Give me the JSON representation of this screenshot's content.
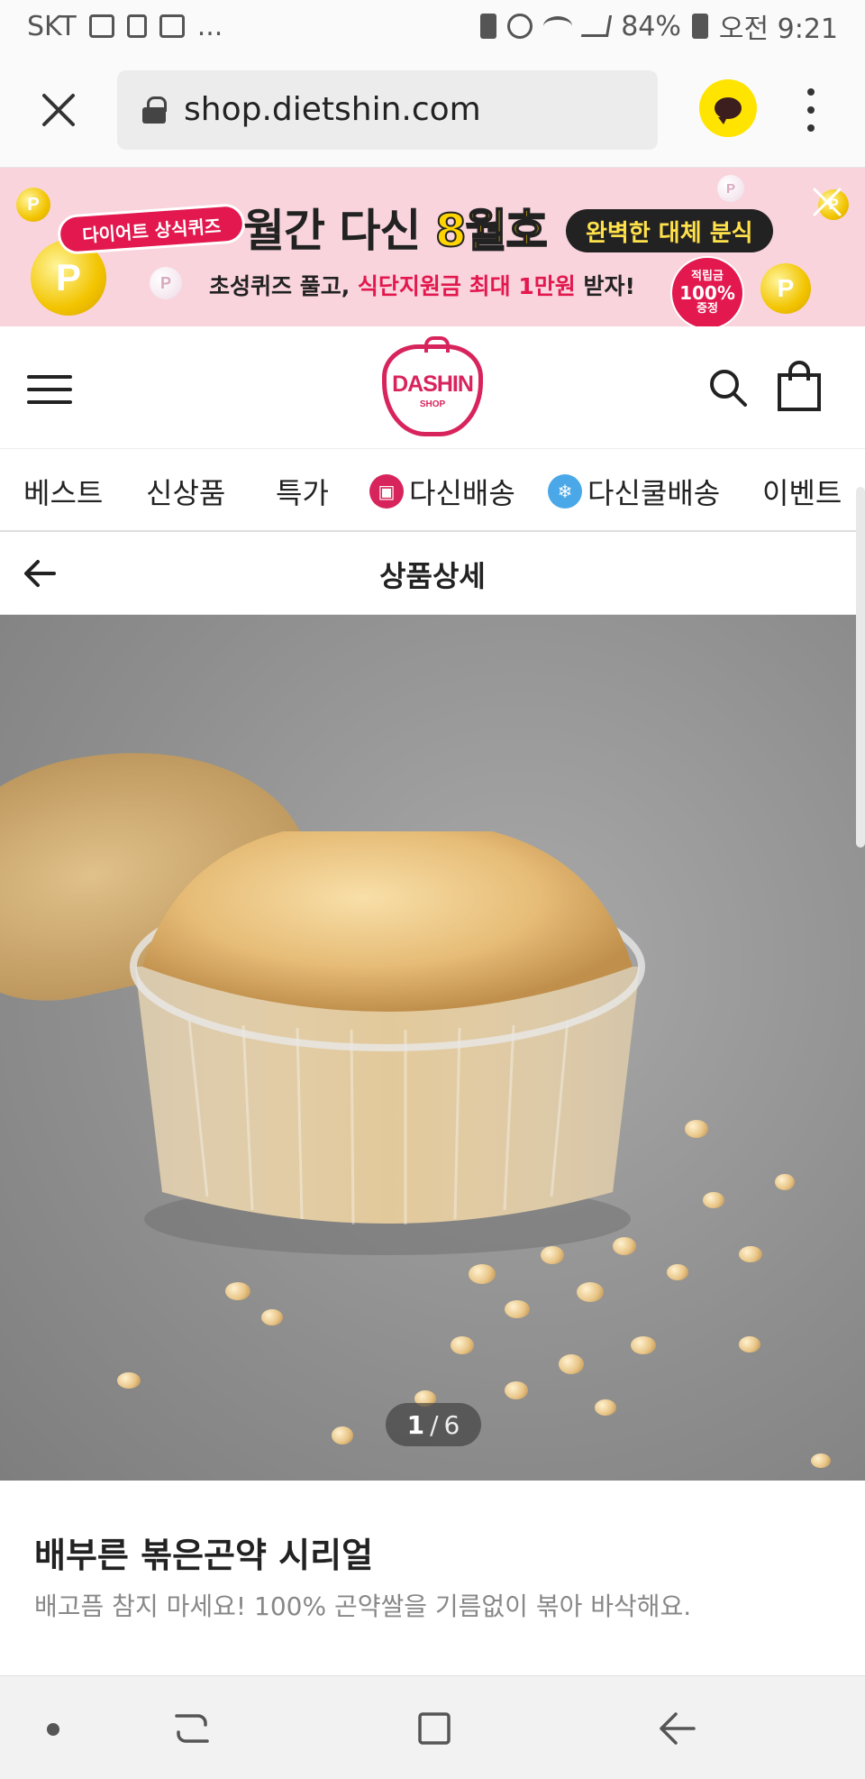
{
  "status_bar": {
    "carrier": "SKT",
    "more": "...",
    "battery": "84%",
    "time": "오전 9:21"
  },
  "browser": {
    "url": "shop.dietshin.com"
  },
  "promo_banner": {
    "tag": "다이어트 상식퀴즈",
    "title_part1": "월간 다신",
    "title_highlight": "8월호",
    "pill": "완벽한 대체 분식",
    "sub_part1": "초성퀴즈 풀고,",
    "sub_highlight": "식단지원금 최대 1만원",
    "sub_part2": "받자!",
    "badge_top": "적립금",
    "badge_mid": "100%",
    "badge_bottom": "증정",
    "coin_letter": "P"
  },
  "site_header": {
    "logo_main": "DASHIN",
    "logo_sub": "SHOP"
  },
  "category_nav": {
    "items": [
      "베스트",
      "신상품",
      "특가",
      "다신배송",
      "다신쿨배송",
      "이벤트"
    ]
  },
  "page_header": {
    "title": "상품상세"
  },
  "gallery": {
    "current": "1",
    "separator": "/",
    "total": "6"
  },
  "product": {
    "name": "배부른 볶은곤약 시리얼",
    "description": "배고픔 참지 마세요! 100% 곤약쌀을 기름없이 볶아 바삭해요."
  },
  "colors": {
    "brand": "#d8245c",
    "kakao": "#ffe400",
    "promo_bg": "#f9d4dd"
  }
}
